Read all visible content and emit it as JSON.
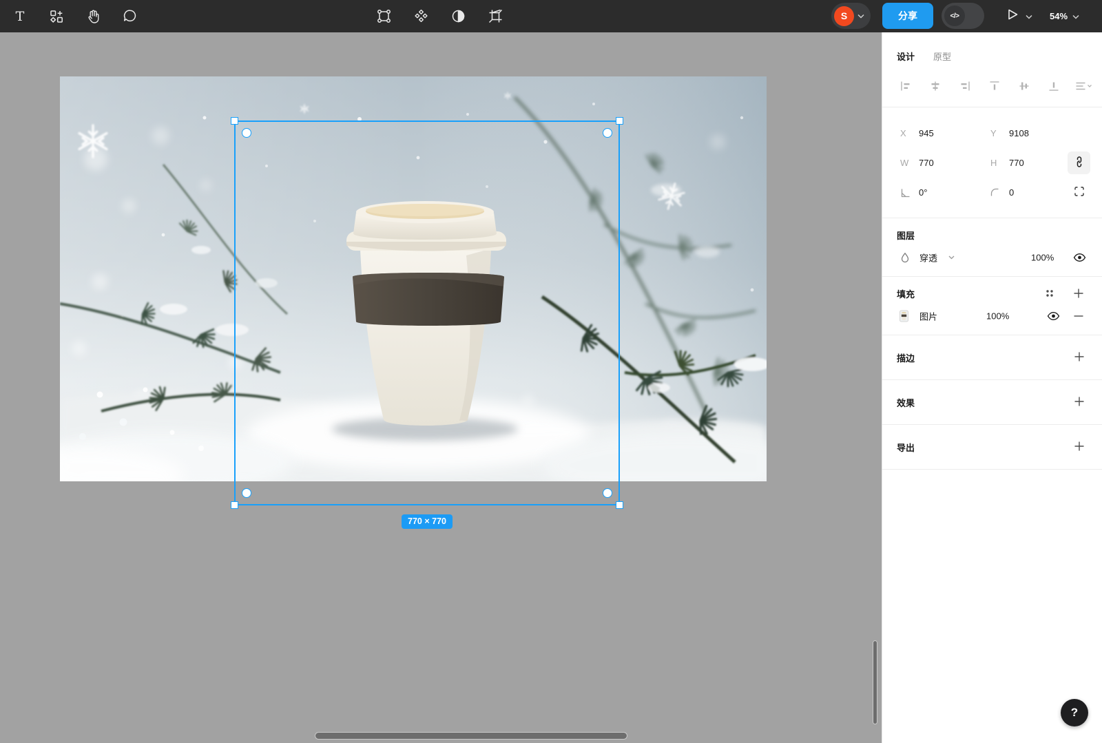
{
  "toolbar": {
    "left_tools": [
      "text-tool",
      "assets",
      "hand-tool",
      "comments"
    ],
    "center_tools": [
      "edit-object",
      "components",
      "mask",
      "crop"
    ],
    "avatar_initial": "S",
    "share_label": "分享",
    "code_toggle": "</>",
    "zoom_level": "54%"
  },
  "canvas": {
    "selection_size_label": "770 × 770"
  },
  "inspector": {
    "tabs": {
      "design": "设计",
      "prototype": "原型"
    },
    "transform": {
      "x_label": "X",
      "x": "945",
      "y_label": "Y",
      "y": "9108",
      "w_label": "W",
      "w": "770",
      "h_label": "H",
      "h": "770",
      "rotation": "0°",
      "corner_radius": "0"
    },
    "layer": {
      "title": "图层",
      "blend_mode": "穿透",
      "opacity": "100%"
    },
    "fill": {
      "title": "填充",
      "type": "图片",
      "opacity": "100%"
    },
    "stroke": {
      "title": "描边"
    },
    "effects": {
      "title": "效果"
    },
    "export": {
      "title": "导出"
    }
  },
  "help": {
    "label": "?"
  },
  "colors": {
    "accent": "#18a0fb",
    "share_button": "#1f9bf0",
    "avatar": "#f2491f",
    "toolbar_bg": "#2c2c2c",
    "canvas_bg": "#a2a2a2"
  }
}
